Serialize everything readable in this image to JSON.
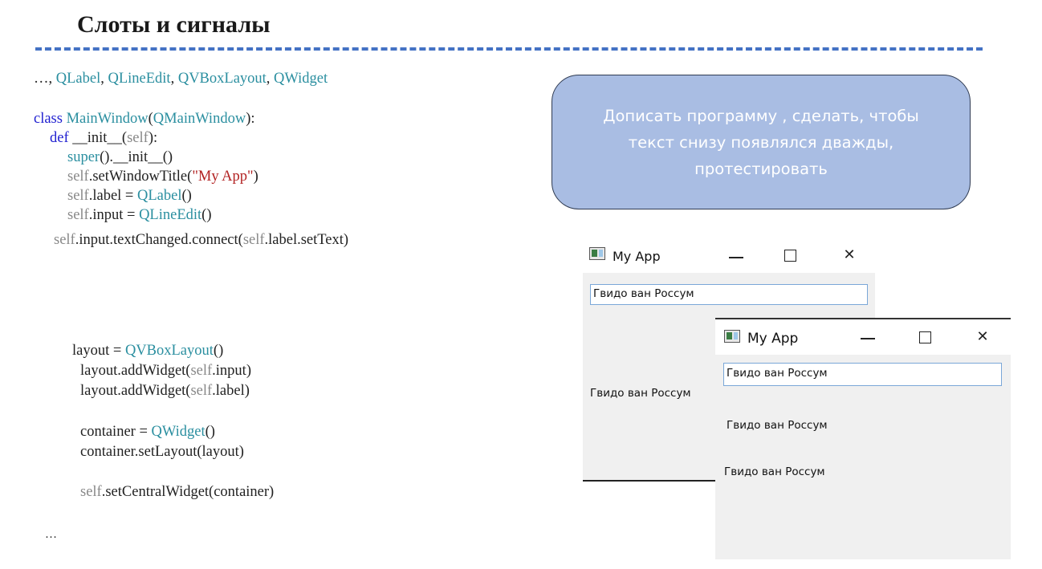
{
  "slide": {
    "title": "Слоты и сигналы"
  },
  "code": {
    "line_import_prefix": "…, ",
    "line_import_items": [
      "QLabel",
      "QLineEdit",
      "QVBoxLayout",
      "QWidget"
    ],
    "class_kw": "class",
    "class_name": "MainWindow",
    "class_base": "QMainWindow",
    "def_kw": "def",
    "init_name": " __init__(",
    "self": "self",
    "super_call": "super",
    "super_rest": "().__init__()",
    "set_title_prefix": ".setWindowTitle(",
    "app_title_str": "\"My App\"",
    "label_assign": ".label = ",
    "qlabel": "QLabel",
    "input_assign": ".input = ",
    "qlineedit": "QLineEdit",
    "connect_rest": ".input.textChanged.connect(",
    "connect_tail": ".label.setText)",
    "layout_assign": "layout = ",
    "qvboxlayout": "QVBoxLayout",
    "add_widget": "layout.addWidget(",
    "input_tail": ".input)",
    "label_tail": ".label)",
    "container_assign": "container = ",
    "qwidget": "QWidget",
    "set_layout": "container.setLayout(layout)",
    "set_central": ".setCentralWidget(container)",
    "ellipsis": "…",
    "parens": "()",
    "colon_close": "):",
    "paren_close": ")"
  },
  "callout": {
    "text_line1": "Дописать программу , сделать, чтобы",
    "text_line2": "текст снизу появлялся дважды,",
    "text_line3": "протестировать"
  },
  "window1": {
    "title": "My App",
    "input_value": "Гвидо ван Россум",
    "label_text": "Гвидо ван Россум"
  },
  "window2": {
    "title": "My App",
    "input_value": "Гвидо ван Россум",
    "label1_text": "Гвидо ван Россум",
    "label2_text": "Гвидо ван Россум"
  },
  "controls": {
    "close_glyph": "✕"
  },
  "colors": {
    "accent_rule": "#4472c4",
    "callout_fill": "#a9bde3",
    "window_body": "#f0f0f0"
  }
}
